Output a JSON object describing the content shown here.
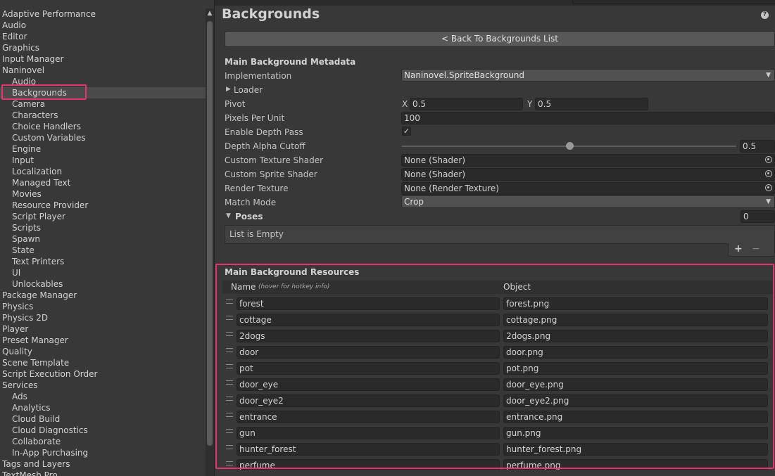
{
  "sidebar": {
    "items": [
      {
        "label": "Adaptive Performance",
        "level": 0
      },
      {
        "label": "Audio",
        "level": 0
      },
      {
        "label": "Editor",
        "level": 0
      },
      {
        "label": "Graphics",
        "level": 0
      },
      {
        "label": "Input Manager",
        "level": 0
      },
      {
        "label": "Naninovel",
        "level": 0
      },
      {
        "label": "Audio",
        "level": 1
      },
      {
        "label": "Backgrounds",
        "level": 1,
        "selected": true
      },
      {
        "label": "Camera",
        "level": 1
      },
      {
        "label": "Characters",
        "level": 1
      },
      {
        "label": "Choice Handlers",
        "level": 1
      },
      {
        "label": "Custom Variables",
        "level": 1
      },
      {
        "label": "Engine",
        "level": 1
      },
      {
        "label": "Input",
        "level": 1
      },
      {
        "label": "Localization",
        "level": 1
      },
      {
        "label": "Managed Text",
        "level": 1
      },
      {
        "label": "Movies",
        "level": 1
      },
      {
        "label": "Resource Provider",
        "level": 1
      },
      {
        "label": "Script Player",
        "level": 1
      },
      {
        "label": "Scripts",
        "level": 1
      },
      {
        "label": "Spawn",
        "level": 1
      },
      {
        "label": "State",
        "level": 1
      },
      {
        "label": "Text Printers",
        "level": 1
      },
      {
        "label": "UI",
        "level": 1
      },
      {
        "label": "Unlockables",
        "level": 1
      },
      {
        "label": "Package Manager",
        "level": 0
      },
      {
        "label": "Physics",
        "level": 0
      },
      {
        "label": "Physics 2D",
        "level": 0
      },
      {
        "label": "Player",
        "level": 0
      },
      {
        "label": "Preset Manager",
        "level": 0
      },
      {
        "label": "Quality",
        "level": 0
      },
      {
        "label": "Scene Template",
        "level": 0
      },
      {
        "label": "Script Execution Order",
        "level": 0
      },
      {
        "label": "Services",
        "level": 0
      },
      {
        "label": "Ads",
        "level": 1
      },
      {
        "label": "Analytics",
        "level": 1
      },
      {
        "label": "Cloud Build",
        "level": 1
      },
      {
        "label": "Cloud Diagnostics",
        "level": 1
      },
      {
        "label": "Collaborate",
        "level": 1
      },
      {
        "label": "In-App Purchasing",
        "level": 1
      },
      {
        "label": "Tags and Layers",
        "level": 0
      },
      {
        "label": "TextMesh Pro",
        "level": 0
      }
    ]
  },
  "header": {
    "title": "Backgrounds",
    "help_icon": "help-icon"
  },
  "back_button": "< Back To Backgrounds List",
  "metadata": {
    "section_title": "Main Background Metadata",
    "implementation_label": "Implementation",
    "implementation_value": "Naninovel.SpriteBackground",
    "loader_label": "Loader",
    "pivot_label": "Pivot",
    "pivot_x_label": "X",
    "pivot_x": "0.5",
    "pivot_y_label": "Y",
    "pivot_y": "0.5",
    "ppu_label": "Pixels Per Unit",
    "ppu_value": "100",
    "depth_pass_label": "Enable Depth Pass",
    "depth_pass_checked": true,
    "depth_alpha_label": "Depth Alpha Cutoff",
    "depth_alpha_value": "0.5",
    "depth_alpha_fraction": 0.5,
    "texture_shader_label": "Custom Texture Shader",
    "texture_shader_value": "None (Shader)",
    "sprite_shader_label": "Custom Sprite Shader",
    "sprite_shader_value": "None (Shader)",
    "render_texture_label": "Render Texture",
    "render_texture_value": "None (Render Texture)",
    "match_mode_label": "Match Mode",
    "match_mode_value": "Crop",
    "poses_label": "Poses",
    "poses_count": "0",
    "poses_empty": "List is Empty",
    "add_symbol": "+",
    "remove_symbol": "−"
  },
  "resources": {
    "section_title": "Main Background Resources",
    "name_header": "Name",
    "name_hint": "(hover for hotkey info)",
    "object_header": "Object",
    "rows": [
      {
        "name": "forest",
        "object": "forest.png"
      },
      {
        "name": "cottage",
        "object": "cottage.png"
      },
      {
        "name": "2dogs",
        "object": "2dogs.png"
      },
      {
        "name": "door",
        "object": "door.png"
      },
      {
        "name": "pot",
        "object": "pot.png"
      },
      {
        "name": "door_eye",
        "object": "door_eye.png"
      },
      {
        "name": "door_eye2",
        "object": "door_eye2.png"
      },
      {
        "name": "entrance",
        "object": "entrance.png"
      },
      {
        "name": "gun",
        "object": "gun.png"
      },
      {
        "name": "hunter_forest",
        "object": "hunter_forest.png"
      },
      {
        "name": "perfume",
        "object": "perfume.png"
      }
    ]
  },
  "colors": {
    "highlight": "#e8346c",
    "panel": "#383838",
    "field": "#2a2a2a"
  }
}
